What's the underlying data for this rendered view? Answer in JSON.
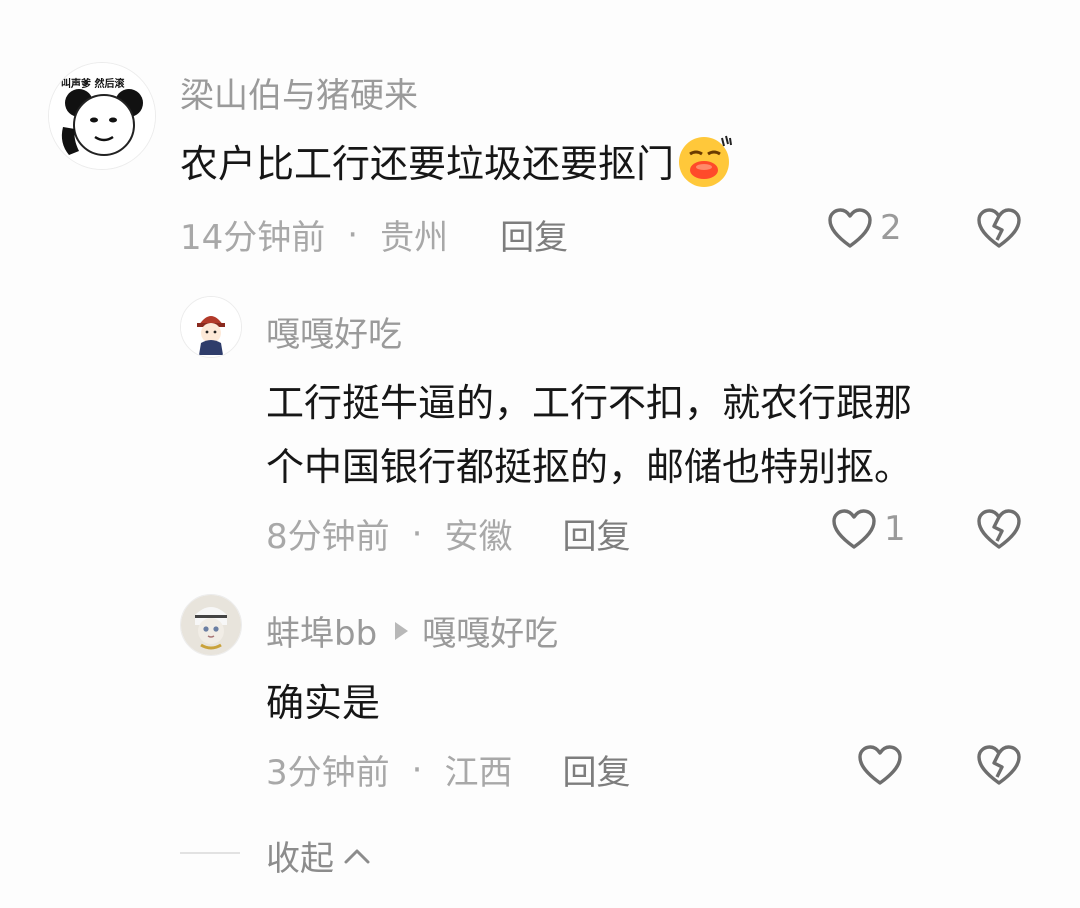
{
  "comments": [
    {
      "username": "梁山伯与猪硬来",
      "avatar_caption": "叫声爹 然后滚",
      "text": "农户比工行还要垃圾还要抠门",
      "emoji": "kiss-face-emoji",
      "time": "14分钟前",
      "location": "贵州",
      "reply_label": "回复",
      "likes": "2"
    },
    {
      "username": "嘎嘎好吃",
      "text_lines": [
        "工行挺牛逼的，工行不扣，就农行跟那",
        "个中国银行都挺抠的，邮储也特别抠。"
      ],
      "time": "8分钟前",
      "location": "安徽",
      "reply_label": "回复",
      "likes": "1"
    },
    {
      "username": "蚌埠bb",
      "reply_to": "嘎嘎好吃",
      "text": "确实是",
      "time": "3分钟前",
      "location": "江西",
      "reply_label": "回复",
      "likes": ""
    }
  ],
  "collapse": {
    "label": "收起"
  },
  "separator": "·",
  "icons": {
    "like": "heart-outline-icon",
    "dislike": "broken-heart-icon",
    "collapse": "chevron-up-icon",
    "reply_arrow": "triangle-right-icon"
  },
  "colors": {
    "name": "#9a9a9a",
    "meta": "#a8a8a8",
    "text": "#161616"
  }
}
